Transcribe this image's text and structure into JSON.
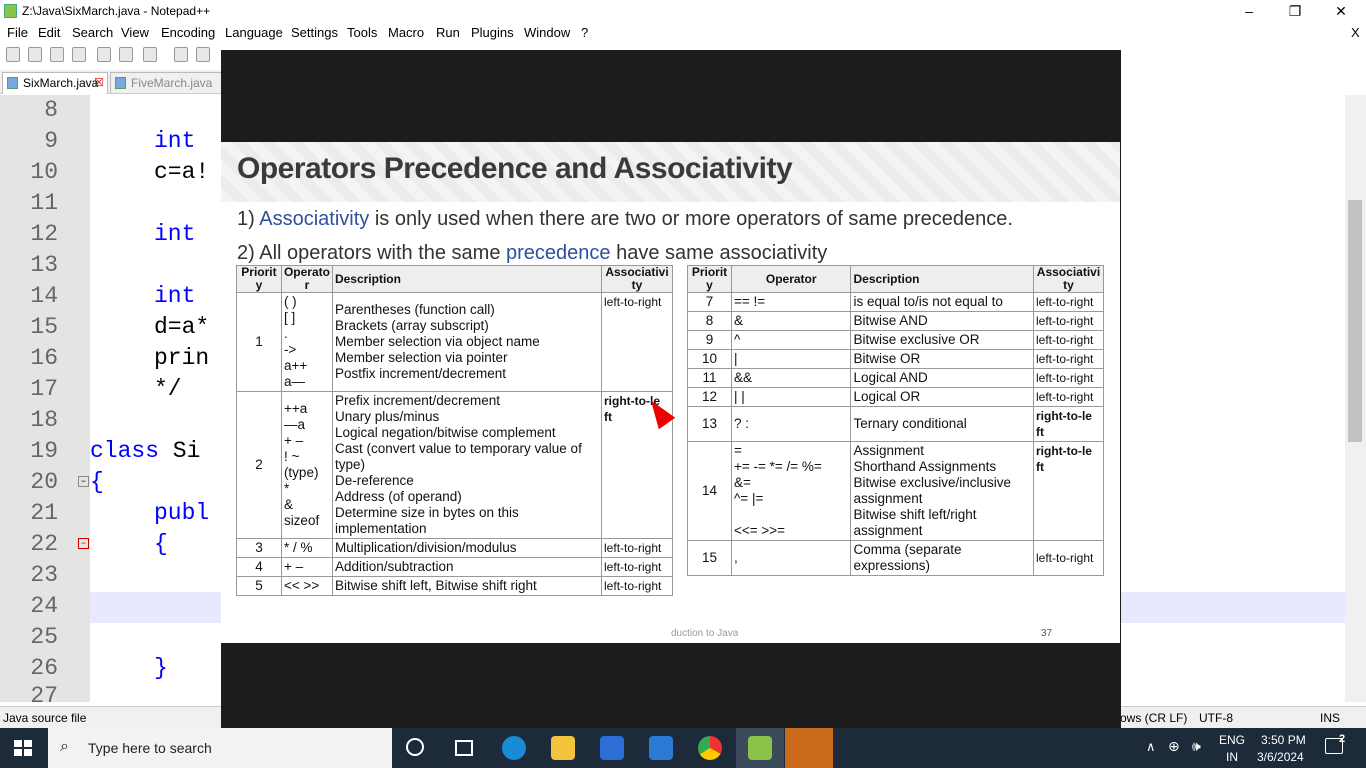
{
  "window": {
    "title": "Z:\\Java\\SixMarch.java - Notepad++",
    "min": "–",
    "max": "❐",
    "close": "✕"
  },
  "menu": [
    "File",
    "Edit",
    "Search",
    "View",
    "Encoding",
    "Language",
    "Settings",
    "Tools",
    "Macro",
    "Run",
    "Plugins",
    "Window",
    "?"
  ],
  "menu_close": "X",
  "tabs": [
    {
      "label": "SixMarch.java"
    },
    {
      "label": "FiveMarch.java"
    }
  ],
  "editor": {
    "line_numbers": [
      "8",
      "9",
      "10",
      "11",
      "12",
      "13",
      "14",
      "15",
      "16",
      "17",
      "18",
      "19",
      "20",
      "21",
      "22",
      "23",
      "24",
      "25",
      "26",
      "27"
    ],
    "lines": {
      "l9": "int",
      "l10": "c=a!",
      "l12": "int",
      "l14": "int",
      "l15": "d=a*",
      "l16": "prin",
      "l17": "*/",
      "l19a": "class",
      "l19b": " Si",
      "l20": "{",
      "l21": "publ",
      "l22": "{",
      "l26": "}"
    }
  },
  "status": {
    "filetype": "Java source file",
    "eol": "ows (CR LF)",
    "encoding": "UTF-8",
    "mode": "INS"
  },
  "taskbar": {
    "search_placeholder": "Type here to search",
    "lang": "ENG",
    "region": "IN",
    "time": "3:50 PM",
    "date": "3/6/2024",
    "notif_count": "2"
  },
  "slide": {
    "title": "Operators Precedence and Associativity",
    "point1_prefix": "1) ",
    "point1_link": "Associativity",
    "point1_rest": " is only used when there are two or more operators of same precedence.",
    "point2_prefix": "2) All operators with the same ",
    "point2_link": "precedence",
    "point2_rest": " have same associativity",
    "footer": "duction to Java",
    "page": "37",
    "left_headers": [
      "Priorit y",
      "Operato r",
      "Description",
      "Associativi ty"
    ],
    "right_headers": [
      "Priorit y",
      "Operator",
      "Description",
      "Associativi ty"
    ],
    "left_rows": [
      {
        "p": "1",
        "op": "( )\n[ ]\n.\n->\na++\na—",
        "desc": "Parentheses (function call)\nBrackets (array subscript)\nMember selection via object name\nMember selection via pointer\nPostfix increment/decrement",
        "assoc": "left-to-right"
      },
      {
        "p": "2",
        "op": "++a\n—a\n+ –\n! ~\n(type)\n*\n&\nsizeof",
        "desc": "Prefix increment/decrement\nUnary plus/minus\nLogical negation/bitwise complement\nCast (convert value to temporary value of type)\nDe-reference\nAddress (of operand)\nDetermine size in bytes on this implementation",
        "assoc": "right-to-le ft"
      },
      {
        "p": "3",
        "op": "*  /  %",
        "desc": "Multiplication/division/modulus",
        "assoc": "left-to-right"
      },
      {
        "p": "4",
        "op": "+  –",
        "desc": "Addition/subtraction",
        "assoc": "left-to-right"
      },
      {
        "p": "5",
        "op": "<<  >>",
        "desc": "Bitwise shift left, Bitwise shift right",
        "assoc": "left-to-right"
      }
    ],
    "right_rows": [
      {
        "p": "7",
        "op": "==  !=",
        "desc": "is equal to/is not equal to",
        "assoc": "left-to-right"
      },
      {
        "p": "8",
        "op": "&",
        "desc": "Bitwise AND",
        "assoc": "left-to-right"
      },
      {
        "p": "9",
        "op": "^",
        "desc": "Bitwise exclusive OR",
        "assoc": "left-to-right"
      },
      {
        "p": "10",
        "op": "|",
        "desc": "Bitwise OR",
        "assoc": "left-to-right"
      },
      {
        "p": "11",
        "op": "&&",
        "desc": "Logical AND",
        "assoc": "left-to-right"
      },
      {
        "p": "12",
        "op": "| |",
        "desc": "Logical OR",
        "assoc": "left-to-right"
      },
      {
        "p": "13",
        "op": "? :",
        "desc": "Ternary conditional",
        "assoc": "right-to-le ft"
      },
      {
        "p": "14",
        "op": "=\n+=  -=  *=  /=  %=\n&=\n^=  |=\n\n<<=  >>=",
        "desc": "Assignment\nShorthand Assignments\nBitwise exclusive/inclusive assignment\nBitwise shift left/right assignment",
        "assoc": "right-to-le ft"
      },
      {
        "p": "15",
        "op": ",",
        "desc": "Comma (separate expressions)",
        "assoc": "left-to-right"
      }
    ]
  }
}
